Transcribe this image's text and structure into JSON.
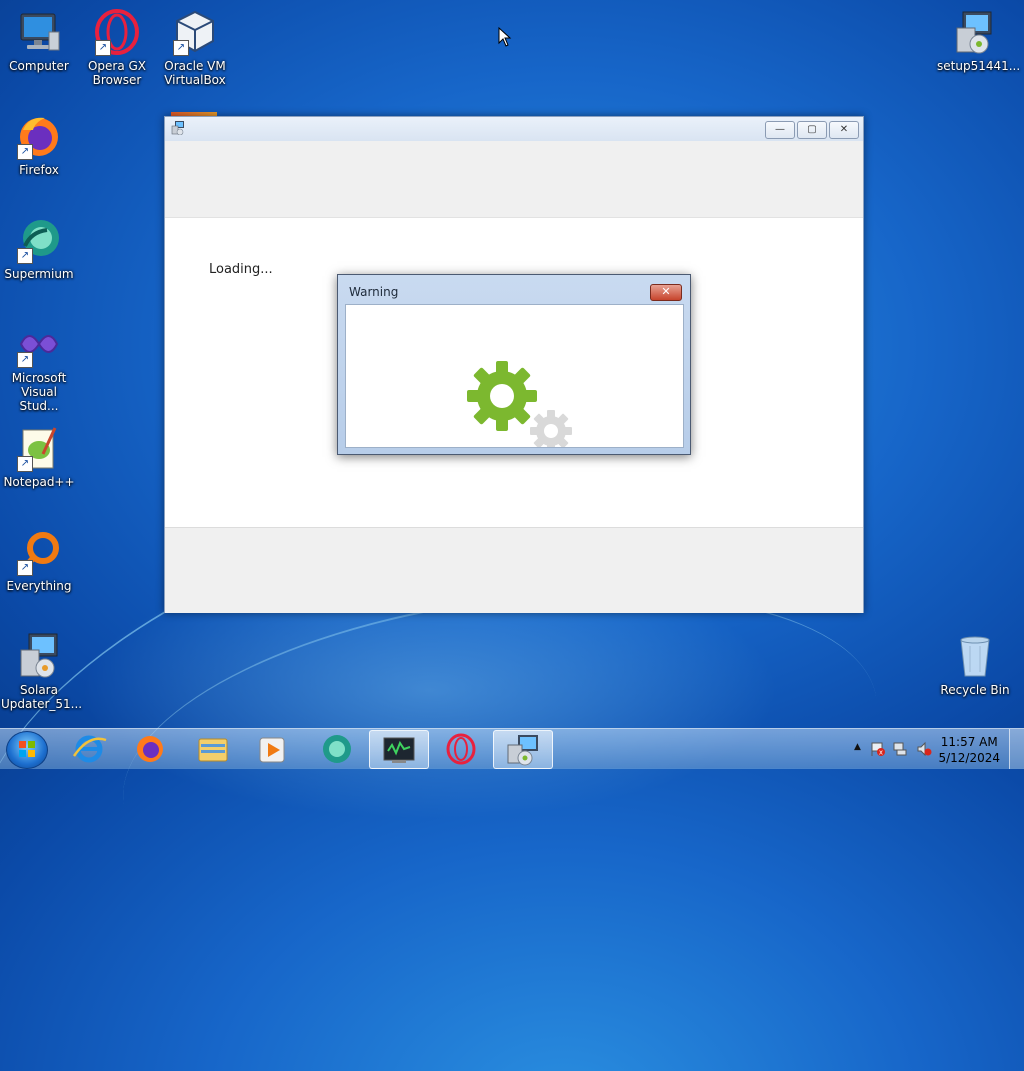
{
  "desktop": {
    "icons": [
      {
        "label": "Computer",
        "icon": "computer-icon"
      },
      {
        "label": "Opera GX Browser",
        "icon": "opera-gx-icon"
      },
      {
        "label": "Oracle VM VirtualBox",
        "icon": "virtualbox-icon"
      },
      {
        "label": "setup51441...",
        "icon": "installer-icon"
      },
      {
        "label": "Firefox",
        "icon": "firefox-icon"
      },
      {
        "label": "Supermium",
        "icon": "supermium-icon"
      },
      {
        "label": "Microsoft Visual Stud...",
        "icon": "visual-studio-icon"
      },
      {
        "label": "Notepad++",
        "icon": "notepad-plus-plus-icon"
      },
      {
        "label": "Everything",
        "icon": "everything-search-icon"
      },
      {
        "label": "Solara Updater_51...",
        "icon": "installer-icon"
      },
      {
        "label": "Recycle Bin",
        "icon": "recycle-bin-icon"
      }
    ]
  },
  "main_window": {
    "loading_text": "Loading...",
    "buttons": {
      "minimize": "—",
      "maximize": "▢",
      "close": "✕"
    }
  },
  "warning_dialog": {
    "title": "Warning",
    "close_label": "✕",
    "gear_colors": {
      "primary": "#7cb82f",
      "secondary": "#d9d9d9"
    }
  },
  "taskbar": {
    "items": [
      "internet-explorer-icon",
      "firefox-icon",
      "file-explorer-icon",
      "media-player-icon",
      "supermium-icon",
      "terminal-app-icon",
      "opera-gx-icon",
      "installer-icon"
    ],
    "active_item": "installer-icon",
    "clock_time": "11:57 AM",
    "clock_date": "5/12/2024"
  }
}
